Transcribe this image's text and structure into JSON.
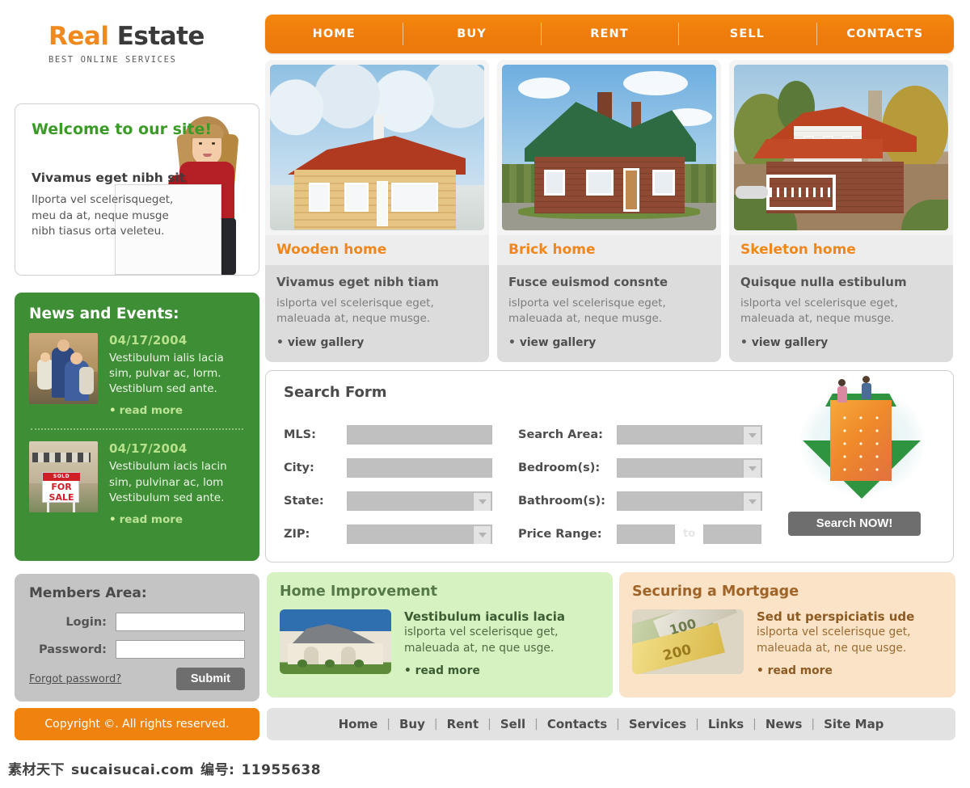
{
  "logo": {
    "title_first": "Real",
    "title_second": "Estate",
    "tagline": "BEST ONLINE SERVICES"
  },
  "topnav": {
    "items": [
      {
        "label": "HOME"
      },
      {
        "label": "BUY"
      },
      {
        "label": "RENT"
      },
      {
        "label": "SELL"
      },
      {
        "label": "CONTACTS"
      }
    ]
  },
  "welcome": {
    "heading": "Welcome to our site!",
    "subheading": "Vivamus eget nibh sit",
    "body": "Ilporta vel scelerisqueget, meu da at, neque musge nibh tiasus orta veleteu."
  },
  "news": {
    "heading": "News and Events:",
    "items": [
      {
        "date": "04/17/2004",
        "text": "Vestibulum ialis lacia sim, pulvar ac, lorm. Vestiblum sed ante.",
        "link": "read more",
        "bullet": "•",
        "image": "family-photo"
      },
      {
        "date": "04/17/2004",
        "text": "Vestibulum iacis lacin sim, pulvinar ac, lom Vestibulum sed ante.",
        "link": "read more",
        "bullet": "•",
        "image": "for-sale-sign-photo"
      }
    ]
  },
  "members": {
    "heading": "Members Area:",
    "login_label": "Login:",
    "login_value": "",
    "password_label": "Password:",
    "password_value": "",
    "forgot_label": "Forgot password?",
    "submit_label": "Submit"
  },
  "copyright": {
    "text": "Copyright ©. All rights reserved."
  },
  "cards": [
    {
      "title": "Wooden home",
      "subtitle": "Vivamus eget nibh tiam",
      "text": "islporta vel scelerisque eget, maleuada at, neque musge.",
      "link": "view gallery",
      "bullet": "•",
      "image": "wooden-house-winter-photo"
    },
    {
      "title": "Brick home",
      "subtitle": "Fusce euismod consnte",
      "text": "islporta vel scelerisque eget, maleuada at, neque musge.",
      "link": "view gallery",
      "bullet": "•",
      "image": "brick-house-green-roof-photo"
    },
    {
      "title": "Skeleton home",
      "subtitle": "Quisque nulla estibulum",
      "text": "islporta vel scelerisque eget, maleuada at, neque musge.",
      "link": "view gallery",
      "bullet": "•",
      "image": "white-siding-house-autumn-photo"
    }
  ],
  "search_form": {
    "title": "Search Form",
    "left_fields": [
      {
        "label": "MLS:",
        "value": "",
        "type": "text"
      },
      {
        "label": "City:",
        "value": "",
        "type": "text"
      },
      {
        "label": "State:",
        "value": "",
        "type": "select"
      },
      {
        "label": "ZIP:",
        "value": "",
        "type": "select"
      }
    ],
    "right_fields": [
      {
        "label": "Search Area:",
        "value": "",
        "type": "select"
      },
      {
        "label": "Bedroom(s):",
        "value": "",
        "type": "select"
      },
      {
        "label": "Bathroom(s):",
        "value": "",
        "type": "select"
      }
    ],
    "price_label": "Price Range:",
    "price_min": "",
    "price_max": "",
    "price_separator": "to",
    "submit_label": "Search NOW!",
    "promo_image": "building-arrow-with-people-illustration"
  },
  "promos": [
    {
      "heading": "Home Improvement",
      "subtitle": "Vestibulum iaculis lacia",
      "text": "islporta vel scelerisque get, maleuada at, ne que usge.",
      "link": "read more",
      "bullet": "•",
      "image": "suburban-house-photo"
    },
    {
      "heading": "Securing a Mortgage",
      "subtitle": "Sed ut perspiciatis ude",
      "text": "islporta vel scelerisque get, maleuada at, ne que usge.",
      "link": "read more",
      "bullet": "•",
      "image": "euro-banknotes-photo"
    }
  ],
  "footnav": {
    "items": [
      {
        "label": "Home"
      },
      {
        "label": "Buy"
      },
      {
        "label": "Rent"
      },
      {
        "label": "Sell"
      },
      {
        "label": "Contacts"
      },
      {
        "label": "Services"
      },
      {
        "label": "Links"
      },
      {
        "label": "News"
      },
      {
        "label": "Site Map"
      }
    ],
    "divider": "|"
  },
  "watermark": {
    "brand": "素材天下",
    "site": "sucaisucai.com",
    "id_label": "编号:",
    "id_value": "11955638"
  },
  "colors": {
    "orange": "#f0820f",
    "green": "#3d8e35",
    "light_green": "#d5f2c0",
    "light_orange": "#fae3c6",
    "grey": "#c4c4c4"
  }
}
